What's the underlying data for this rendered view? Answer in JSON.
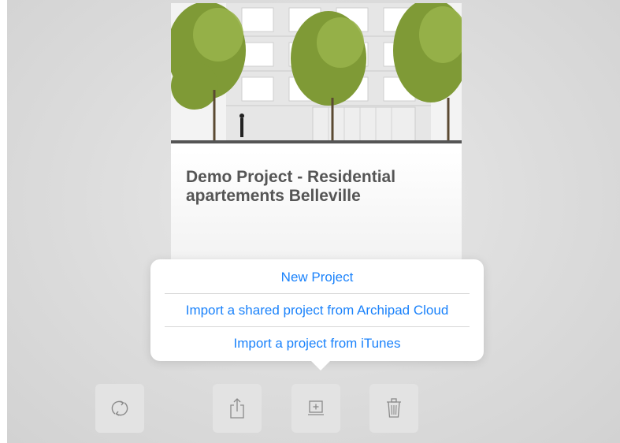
{
  "card": {
    "title": "Demo Project - Residential apartements Belleville"
  },
  "menu": {
    "items": [
      {
        "label": "New Project"
      },
      {
        "label": "Import a shared project from Archipad Cloud"
      },
      {
        "label": "Import a project from iTunes"
      }
    ],
    "accent_color": "#1a82fb"
  },
  "toolbar": {
    "buttons": [
      {
        "icon": "sync-icon"
      },
      {
        "icon": "share-icon"
      },
      {
        "icon": "add-project-icon"
      },
      {
        "icon": "trash-icon"
      }
    ]
  }
}
